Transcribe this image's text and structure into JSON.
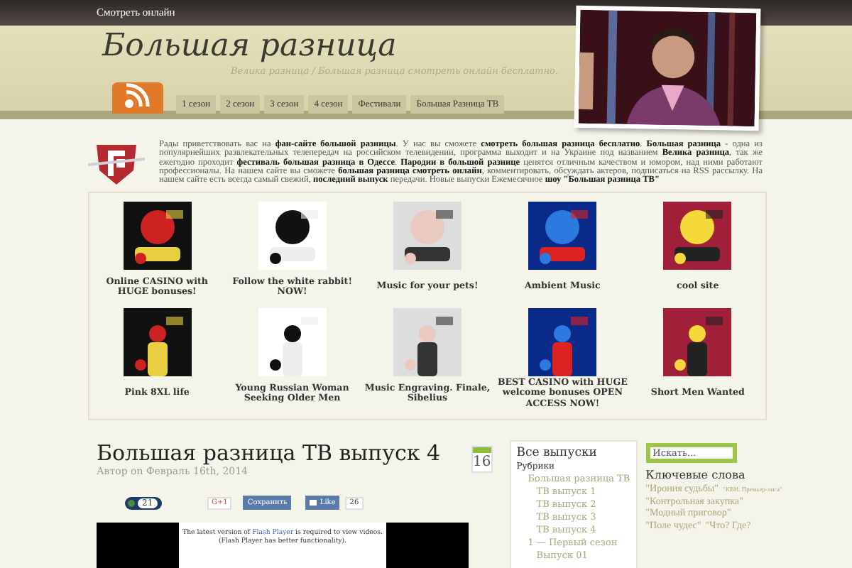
{
  "top_bar": {
    "link": "Смотреть онлайн"
  },
  "header": {
    "title": "Большая разница",
    "tagline": "Велика разница / Большая разница смотреть онлайн бесплатно.",
    "nav": [
      {
        "label": "1 сезон"
      },
      {
        "label": "2 сезон"
      },
      {
        "label": "3 сезон"
      },
      {
        "label": "4 сезон"
      },
      {
        "label": "Фестивали"
      },
      {
        "label": "Большая Разница ТВ"
      }
    ]
  },
  "intro": "Рады приветствовать вас на **фан-сайте большой разницы**. У нас вы сможете **смотреть большая разница бесплатно**. **Большая разница** - одна из популярнейших развлекательных телепередач на российском телевидении, программа выходит и на Украине под названием **Велика разница**, так же ежегодно проходит **фестиваль большая разница в Одессе**. **Пародии в большой разнице** ценятся отличным качеством и юмором, над ними работают профессионалы. На нашем сайте вы сможете **большая разница смотреть онлайн**, комментировать, обсуждать актеров, подписаться на RSS рассылку. На нашем сайте есть всегда самый свежий, **последний выпуск** передачи. Новые выпуски Ежемесячное **шоу \"Большая разница ТВ\"**",
  "ads": [
    {
      "caption": "Online CASINO with HUGE bonuses!"
    },
    {
      "caption": "Follow the white rabbit! NOW!"
    },
    {
      "caption": "Music for your pets!"
    },
    {
      "caption": "Ambient Music"
    },
    {
      "caption": "cool site"
    },
    {
      "caption": "Pink 8XL life"
    },
    {
      "caption": "Young Russian Woman Seeking Older Men"
    },
    {
      "caption": "Music Engraving. Finale, Sibelius"
    },
    {
      "caption": "BEST CASINO with HUGE welcome bonuses OPEN ACCESS NOW!"
    },
    {
      "caption": "Short Men Wanted"
    }
  ],
  "post": {
    "title": "Большая разница ТВ выпуск 4",
    "meta": "Автор on Февраль 16th, 2014",
    "date_day": "16",
    "social": {
      "counter": "21",
      "gplus": "G+1",
      "save": "Сохранить",
      "like": "Like",
      "like_count": "26"
    },
    "flash": {
      "before": "The latest version of",
      "link": "Flash Player",
      "after": "is required to view videos.",
      "note": "(Flash Player has better functionality)."
    }
  },
  "archive": {
    "title": "Все выпуски",
    "heading": "Рубрики",
    "items": [
      {
        "label": "Большая разница ТВ",
        "children": [
          {
            "label": "ТВ выпуск 1"
          },
          {
            "label": "ТВ выпуск 2"
          },
          {
            "label": "ТВ выпуск 3"
          },
          {
            "label": "ТВ выпуск 4"
          }
        ]
      },
      {
        "label": "1 — Первый сезон",
        "children": [
          {
            "label": "Выпуск 01"
          }
        ]
      }
    ]
  },
  "search": {
    "placeholder": "Искать..."
  },
  "tags": {
    "title": "Ключевые слова",
    "items": [
      {
        "label": "\"Ирония судьбы\"",
        "kind": "large"
      },
      {
        "label": "\"КВН. Премьер-лига\"",
        "kind": "small"
      },
      {
        "label": "\"Контрольная закупка\"",
        "kind": "large"
      },
      {
        "label": "\"Модный приговор\"",
        "kind": "large"
      },
      {
        "label": "\"Поле чудес\"",
        "kind": "large"
      },
      {
        "label": "\"Что? Где?",
        "kind": "large"
      }
    ]
  }
}
